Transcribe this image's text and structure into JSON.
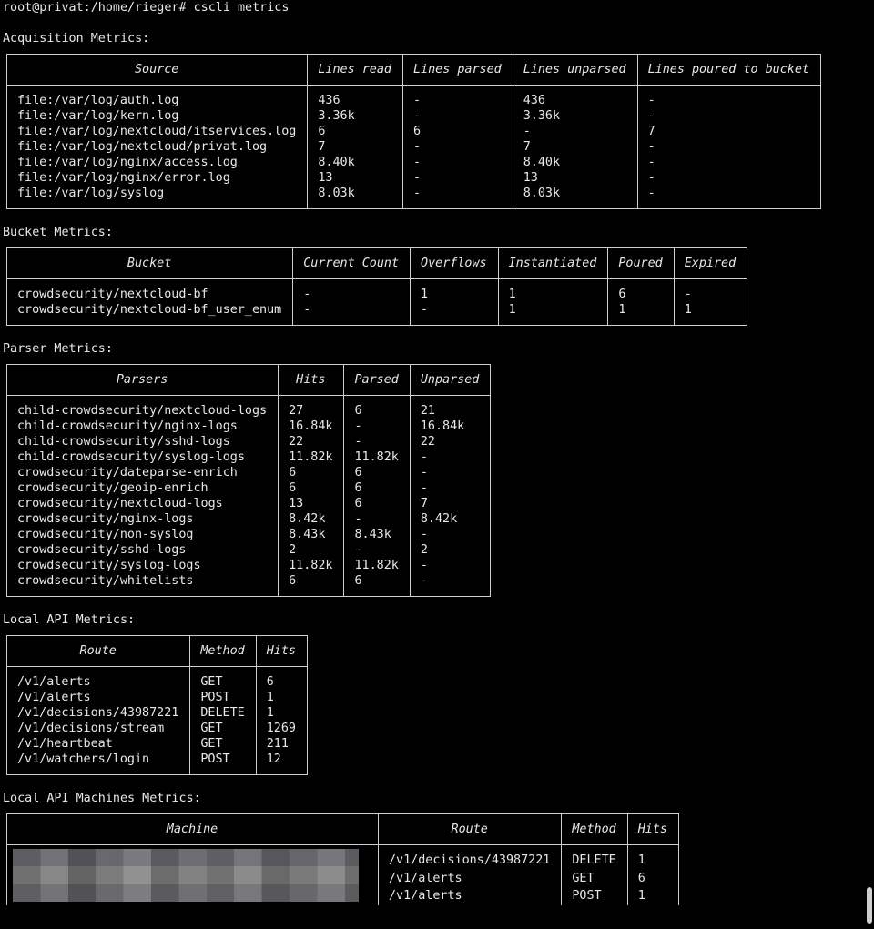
{
  "prompt": "root@privat:/home/rieger# cscli metrics",
  "acquisition": {
    "title": "Acquisition Metrics:",
    "headers": [
      "Source",
      "Lines read",
      "Lines parsed",
      "Lines unparsed",
      "Lines poured to bucket"
    ],
    "rows": [
      [
        "file:/var/log/auth.log",
        "436",
        "-",
        "436",
        "-"
      ],
      [
        "file:/var/log/kern.log",
        "3.36k",
        "-",
        "3.36k",
        "-"
      ],
      [
        "file:/var/log/nextcloud/itservices.log",
        "6",
        "6",
        "-",
        "7"
      ],
      [
        "file:/var/log/nextcloud/privat.log",
        "7",
        "-",
        "7",
        "-"
      ],
      [
        "file:/var/log/nginx/access.log",
        "8.40k",
        "-",
        "8.40k",
        "-"
      ],
      [
        "file:/var/log/nginx/error.log",
        "13",
        "-",
        "13",
        "-"
      ],
      [
        "file:/var/log/syslog",
        "8.03k",
        "-",
        "8.03k",
        "-"
      ]
    ]
  },
  "bucket": {
    "title": "Bucket Metrics:",
    "headers": [
      "Bucket",
      "Current Count",
      "Overflows",
      "Instantiated",
      "Poured",
      "Expired"
    ],
    "rows": [
      [
        "crowdsecurity/nextcloud-bf",
        "-",
        "1",
        "1",
        "6",
        "-"
      ],
      [
        "crowdsecurity/nextcloud-bf_user_enum",
        "-",
        "-",
        "1",
        "1",
        "1"
      ]
    ]
  },
  "parser": {
    "title": "Parser Metrics:",
    "headers": [
      "Parsers",
      "Hits",
      "Parsed",
      "Unparsed"
    ],
    "rows": [
      [
        "child-crowdsecurity/nextcloud-logs",
        "27",
        "6",
        "21"
      ],
      [
        "child-crowdsecurity/nginx-logs",
        "16.84k",
        "-",
        "16.84k"
      ],
      [
        "child-crowdsecurity/sshd-logs",
        "22",
        "-",
        "22"
      ],
      [
        "child-crowdsecurity/syslog-logs",
        "11.82k",
        "11.82k",
        "-"
      ],
      [
        "crowdsecurity/dateparse-enrich",
        "6",
        "6",
        "-"
      ],
      [
        "crowdsecurity/geoip-enrich",
        "6",
        "6",
        "-"
      ],
      [
        "crowdsecurity/nextcloud-logs",
        "13",
        "6",
        "7"
      ],
      [
        "crowdsecurity/nginx-logs",
        "8.42k",
        "-",
        "8.42k"
      ],
      [
        "crowdsecurity/non-syslog",
        "8.43k",
        "8.43k",
        "-"
      ],
      [
        "crowdsecurity/sshd-logs",
        "2",
        "-",
        "2"
      ],
      [
        "crowdsecurity/syslog-logs",
        "11.82k",
        "11.82k",
        "-"
      ],
      [
        "crowdsecurity/whitelists",
        "6",
        "6",
        "-"
      ]
    ]
  },
  "lapi": {
    "title": "Local API Metrics:",
    "headers": [
      "Route",
      "Method",
      "Hits"
    ],
    "rows": [
      [
        "/v1/alerts",
        "GET",
        "6"
      ],
      [
        "/v1/alerts",
        "POST",
        "1"
      ],
      [
        "/v1/decisions/43987221",
        "DELETE",
        "1"
      ],
      [
        "/v1/decisions/stream",
        "GET",
        "1269"
      ],
      [
        "/v1/heartbeat",
        "GET",
        "211"
      ],
      [
        "/v1/watchers/login",
        "POST",
        "12"
      ]
    ]
  },
  "machines": {
    "title": "Local API Machines Metrics:",
    "headers": [
      "Machine",
      "Route",
      "Method",
      "Hits"
    ],
    "rows": [
      [
        "/v1/decisions/43987221",
        "DELETE",
        "1"
      ],
      [
        "/v1/alerts",
        "GET",
        "6"
      ],
      [
        "/v1/alerts",
        "POST",
        "1"
      ]
    ]
  },
  "colors": {
    "background": "#000000",
    "text": "#e8e8e8",
    "border": "#cfcfcf"
  }
}
